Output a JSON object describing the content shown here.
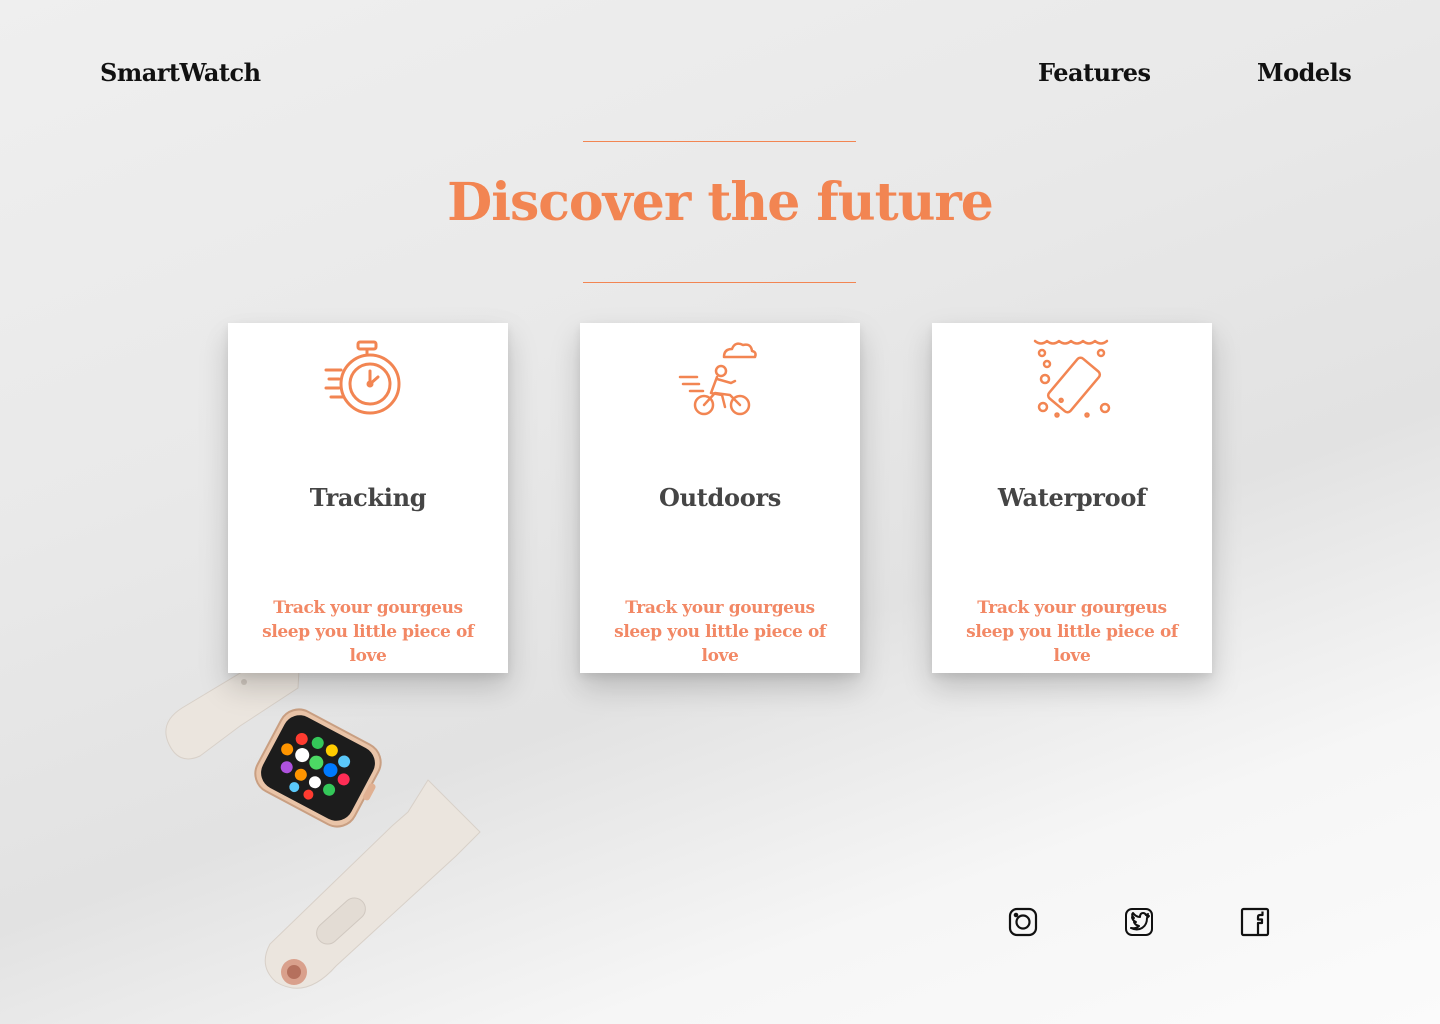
{
  "header": {
    "brand": "SmartWatch",
    "nav": [
      {
        "label": "Features"
      },
      {
        "label": "Models"
      }
    ]
  },
  "hero": {
    "title": "Discover the future"
  },
  "cards": [
    {
      "title": "Tracking",
      "description": "Track your gourgeus sleep you little piece of love",
      "icon": "stopwatch-icon"
    },
    {
      "title": "Outdoors",
      "description": "Track your gourgeus sleep you little piece of love",
      "icon": "cyclist-icon"
    },
    {
      "title": "Waterproof",
      "description": "Track your gourgeus sleep you little piece of love",
      "icon": "waterproof-phone-icon"
    }
  ],
  "social": [
    {
      "icon": "instagram-icon"
    },
    {
      "icon": "twitter-icon"
    },
    {
      "icon": "facebook-icon"
    }
  ],
  "colors": {
    "accent": "#f28552",
    "card_title": "#454545",
    "text_dark": "#111111"
  }
}
